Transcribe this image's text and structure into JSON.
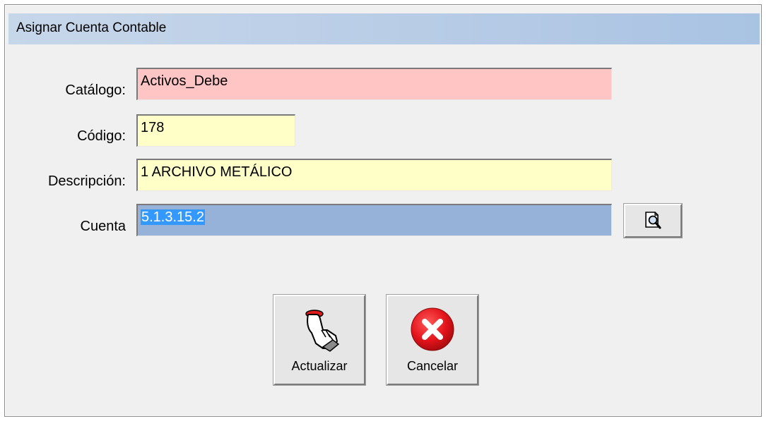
{
  "dialog": {
    "title": "Asignar Cuenta Contable"
  },
  "form": {
    "catalogo_label": "Catálogo:",
    "catalogo_value": "Activos_Debe",
    "codigo_label": "Código:",
    "codigo_value": "178",
    "descripcion_label": "Descripción:",
    "descripcion_value": "1 ARCHIVO METÁLICO",
    "cuenta_label": "Cuenta",
    "cuenta_value": "5.1.3.15.2"
  },
  "buttons": {
    "search_icon": "search-document-icon",
    "actualizar_label": "Actualizar",
    "actualizar_icon": "hand-pointer-icon",
    "cancelar_label": "Cancelar",
    "cancelar_icon": "cancel-x-icon"
  },
  "colors": {
    "catalogo_bg": "#ffc4c4",
    "field_bg": "#ffffc8",
    "cuenta_bg": "#96b2d8",
    "title_bg": "#b8cce6",
    "cancel_red": "#e3141b"
  }
}
